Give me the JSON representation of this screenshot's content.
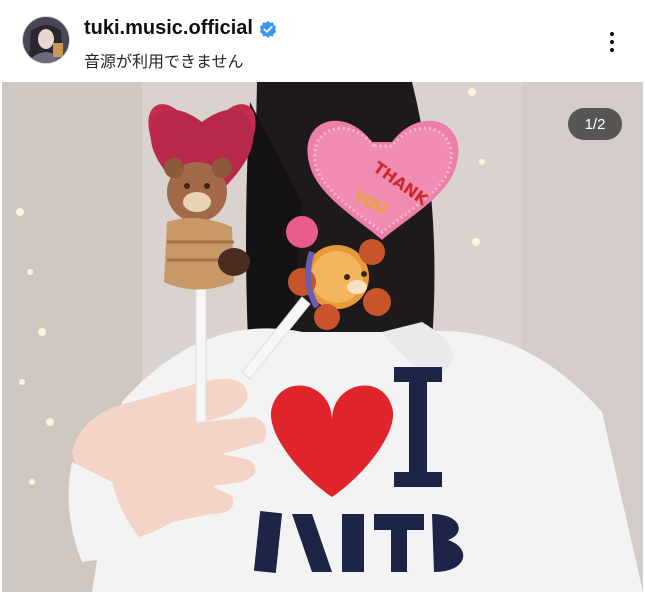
{
  "post": {
    "username": "tuki.music.official",
    "audio_status": "音源が利用できません",
    "page_indicator": "1/2",
    "verified_badge_color": "#3897f0"
  },
  "image": {
    "shirt_text_top": "I",
    "shirt_text_bottom": "SAINTS",
    "candy_text": "THANK YOU"
  },
  "icons": {
    "verified": "verified-badge-icon",
    "more": "more-options-icon"
  }
}
